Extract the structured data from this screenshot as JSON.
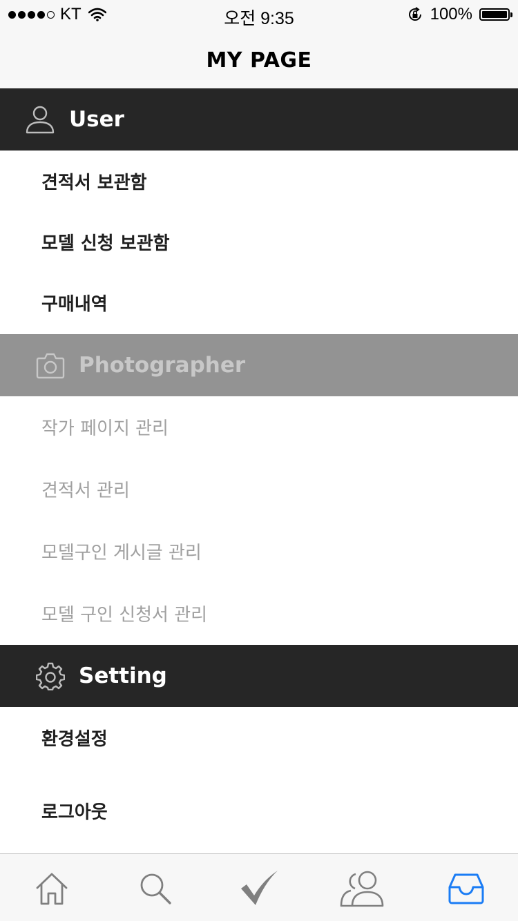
{
  "status_bar": {
    "carrier": "KT",
    "time": "오전 9:35",
    "battery_text": "100%",
    "battery_level": 1.0,
    "signal_bars_filled": 4,
    "signal_bars_total": 5,
    "icons": [
      "signal-dots-icon",
      "wifi-icon",
      "rotation-lock-icon",
      "battery-icon"
    ]
  },
  "navbar": {
    "title": "MY PAGE"
  },
  "sections": {
    "user": {
      "label": "User",
      "icon": "user-icon",
      "items": [
        "견적서 보관함",
        "모델 신청 보관함",
        "구매내역"
      ]
    },
    "photographer": {
      "label": "Photographer",
      "icon": "camera-icon",
      "items": [
        "작가 페이지 관리",
        "견적서 관리",
        "모델구인 게시글 관리",
        "모델 구인 신청서 관리"
      ]
    },
    "setting": {
      "label": "Setting",
      "icon": "gear-icon",
      "items": [
        "환경설정",
        "로그아웃"
      ]
    }
  },
  "tabbar": {
    "tabs": [
      {
        "icon": "home-icon",
        "selected": false
      },
      {
        "icon": "search-icon",
        "selected": false
      },
      {
        "icon": "checkmark-icon",
        "selected": false
      },
      {
        "icon": "people-icon",
        "selected": false
      },
      {
        "icon": "inbox-icon",
        "selected": true
      }
    ]
  },
  "colors": {
    "header_dark": "#262626",
    "header_disabled": "#939393",
    "text_active": "#1f1f1f",
    "text_muted": "#a0a0a0",
    "tab_inactive": "#7f7f7f",
    "tab_active": "#1a7cf5"
  }
}
